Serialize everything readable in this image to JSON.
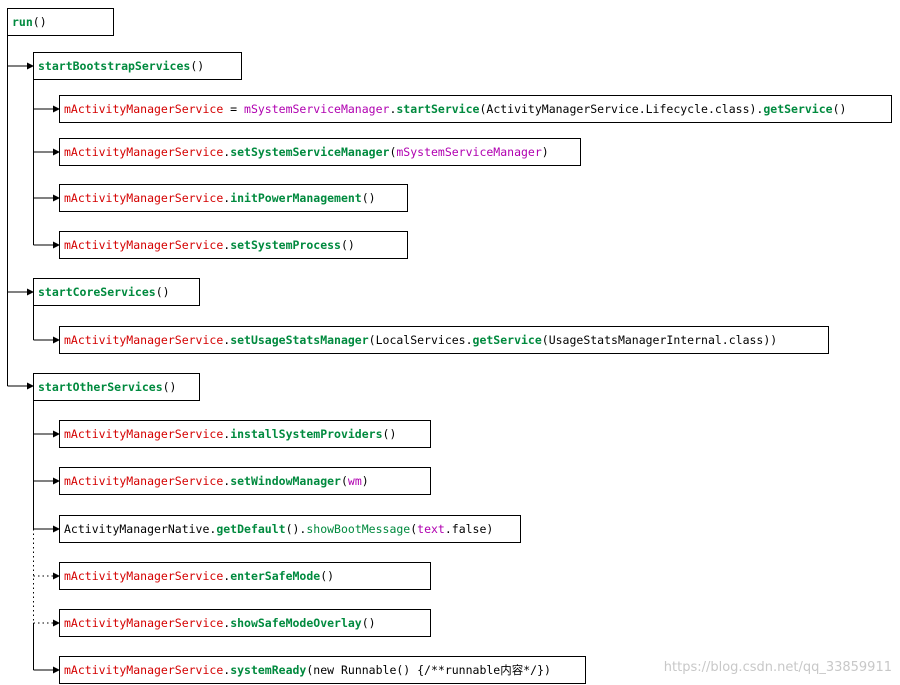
{
  "nodes": [
    {
      "id": "run",
      "segments": [
        {
          "text": "run",
          "style": "green"
        },
        {
          "text": "()",
          "style": "black"
        }
      ]
    },
    {
      "id": "startBootstrapServices",
      "segments": [
        {
          "text": "startBootstrapServices",
          "style": "green"
        },
        {
          "text": "()",
          "style": "black"
        }
      ]
    },
    {
      "id": "bootstrap-1",
      "segments": [
        {
          "text": "mActivityManagerService",
          "style": "red"
        },
        {
          "text": " = ",
          "style": "black"
        },
        {
          "text": "mSystemServiceManager",
          "style": "purple"
        },
        {
          "text": ".",
          "style": "black"
        },
        {
          "text": "startService",
          "style": "green"
        },
        {
          "text": "(ActivityManagerService.Lifecycle.class).",
          "style": "black"
        },
        {
          "text": "getService",
          "style": "green"
        },
        {
          "text": "()",
          "style": "black"
        }
      ]
    },
    {
      "id": "bootstrap-2",
      "segments": [
        {
          "text": "mActivityManagerService",
          "style": "red"
        },
        {
          "text": ".",
          "style": "black"
        },
        {
          "text": "setSystemServiceManager",
          "style": "green"
        },
        {
          "text": "(",
          "style": "black"
        },
        {
          "text": "mSystemServiceManager",
          "style": "purple"
        },
        {
          "text": ")",
          "style": "black"
        }
      ]
    },
    {
      "id": "bootstrap-3",
      "segments": [
        {
          "text": "mActivityManagerService",
          "style": "red"
        },
        {
          "text": ".",
          "style": "black"
        },
        {
          "text": "initPowerManagement",
          "style": "green"
        },
        {
          "text": "()",
          "style": "black"
        }
      ]
    },
    {
      "id": "bootstrap-4",
      "segments": [
        {
          "text": "mActivityManagerService",
          "style": "red"
        },
        {
          "text": ".",
          "style": "black"
        },
        {
          "text": "setSystemProcess",
          "style": "green"
        },
        {
          "text": "()",
          "style": "black"
        }
      ]
    },
    {
      "id": "startCoreServices",
      "segments": [
        {
          "text": "startCoreServices",
          "style": "green"
        },
        {
          "text": "()",
          "style": "black"
        }
      ]
    },
    {
      "id": "core-1",
      "segments": [
        {
          "text": "mActivityManagerService",
          "style": "red"
        },
        {
          "text": ".",
          "style": "black"
        },
        {
          "text": "setUsageStatsManager",
          "style": "green"
        },
        {
          "text": "(LocalServices.",
          "style": "black"
        },
        {
          "text": "getService",
          "style": "green"
        },
        {
          "text": "(UsageStatsManagerInternal.class))",
          "style": "black"
        }
      ]
    },
    {
      "id": "startOtherServices",
      "segments": [
        {
          "text": "startOtherServices",
          "style": "green"
        },
        {
          "text": "()",
          "style": "black"
        }
      ]
    },
    {
      "id": "other-1",
      "segments": [
        {
          "text": "mActivityManagerService",
          "style": "red"
        },
        {
          "text": ".",
          "style": "black"
        },
        {
          "text": "installSystemProviders",
          "style": "green"
        },
        {
          "text": "()",
          "style": "black"
        }
      ]
    },
    {
      "id": "other-2",
      "segments": [
        {
          "text": "mActivityManagerService",
          "style": "red"
        },
        {
          "text": ".",
          "style": "black"
        },
        {
          "text": "setWindowManager",
          "style": "green"
        },
        {
          "text": "(",
          "style": "black"
        },
        {
          "text": "wm",
          "style": "purple"
        },
        {
          "text": ")",
          "style": "black"
        }
      ]
    },
    {
      "id": "other-3",
      "segments": [
        {
          "text": "ActivityManagerNative.",
          "style": "black"
        },
        {
          "text": "getDefault",
          "style": "green"
        },
        {
          "text": "().",
          "style": "black"
        },
        {
          "text": "showBootMessage",
          "style": "greenr"
        },
        {
          "text": "(",
          "style": "black"
        },
        {
          "text": "text",
          "style": "purple"
        },
        {
          "text": ".false)",
          "style": "black"
        }
      ]
    },
    {
      "id": "other-4",
      "segments": [
        {
          "text": "mActivityManagerService",
          "style": "red"
        },
        {
          "text": ".",
          "style": "black"
        },
        {
          "text": "enterSafeMode",
          "style": "green"
        },
        {
          "text": "()",
          "style": "black"
        }
      ]
    },
    {
      "id": "other-5",
      "segments": [
        {
          "text": "mActivityManagerService",
          "style": "red"
        },
        {
          "text": ".",
          "style": "black"
        },
        {
          "text": "showSafeModeOverlay",
          "style": "green"
        },
        {
          "text": "()",
          "style": "black"
        }
      ]
    },
    {
      "id": "other-6",
      "segments": [
        {
          "text": "mActivityManagerService",
          "style": "red"
        },
        {
          "text": ".",
          "style": "black"
        },
        {
          "text": "systemReady",
          "style": "green"
        },
        {
          "text": "(new Runnable() {/**runnable内容*/})",
          "style": "black"
        }
      ]
    }
  ],
  "watermark": "https://blog.csdn.net/qq_33859911"
}
